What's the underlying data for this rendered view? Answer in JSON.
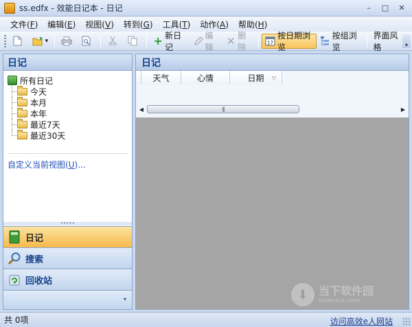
{
  "window": {
    "title": "ss.edfx - 效能日记本 - 日记",
    "min_glyph": "–",
    "max_glyph": "□",
    "close_glyph": "✕"
  },
  "menu": [
    {
      "label": "文件",
      "key": "F"
    },
    {
      "label": "编辑",
      "key": "E"
    },
    {
      "label": "视图",
      "key": "V"
    },
    {
      "label": "转到",
      "key": "G"
    },
    {
      "label": "工具",
      "key": "T"
    },
    {
      "label": "动作",
      "key": "A"
    },
    {
      "label": "帮助",
      "key": "H"
    }
  ],
  "toolbar": {
    "new_entry": "新日记",
    "edit": "编辑",
    "delete": "删除",
    "by_date": "按日期浏览",
    "by_group": "按组浏览",
    "theme": "界面风格",
    "theme_arrow": "▾",
    "open_arrow": "▾",
    "chevron": "▾"
  },
  "left_panel": {
    "title": "日记",
    "tree_root": "所有日记",
    "tree_items": [
      "今天",
      "本月",
      "本年",
      "最近7天",
      "最近30天"
    ],
    "custom_view": "自定义当前视图",
    "custom_view_key": "U",
    "custom_view_suffix": "...",
    "splitter": "•••••",
    "nav": [
      "日记",
      "搜索",
      "回收站"
    ],
    "footer_arrow": "▾"
  },
  "right_panel": {
    "title": "日记",
    "columns": [
      "天气",
      "心情",
      "日期"
    ],
    "sort_glyph": "▽",
    "scroll_left": "◀",
    "scroll_right": "▶",
    "thumb_grip": "|||"
  },
  "watermark": {
    "text": "当下软件园",
    "sub": "downxia.com"
  },
  "status": {
    "count": "共 0项",
    "link": "访问高效e人网站"
  }
}
